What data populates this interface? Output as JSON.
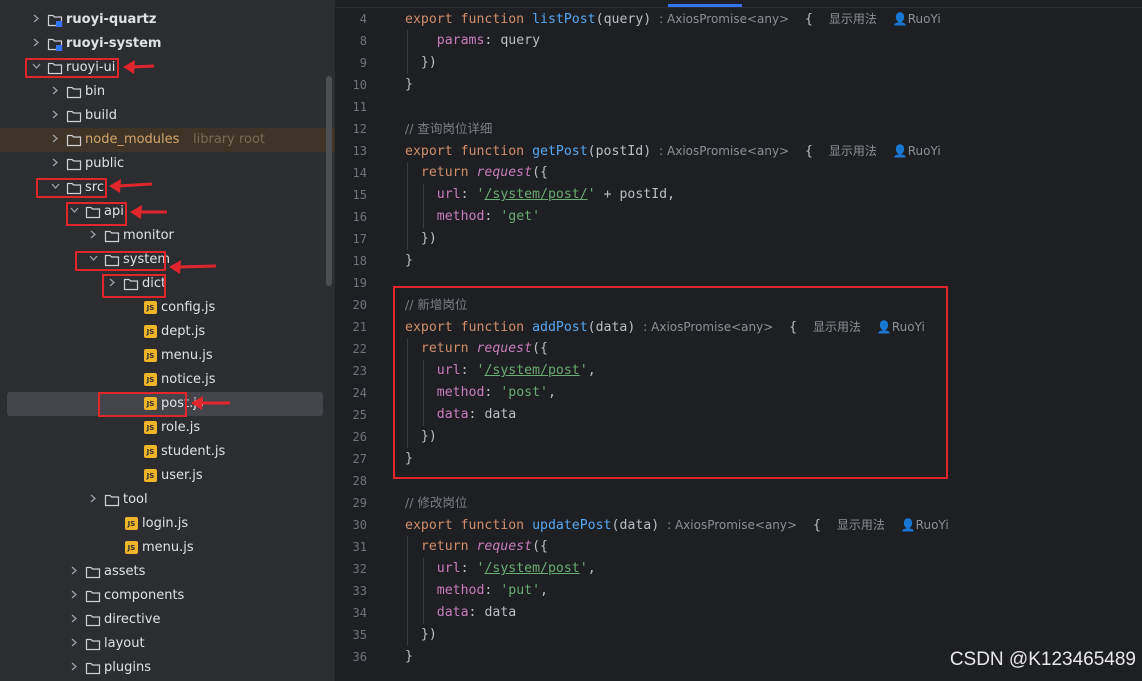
{
  "colors": {
    "annotation": "#e0252c",
    "selection": "#43454a",
    "accent": "#3574f0"
  },
  "tree": {
    "items": [
      {
        "label": "ruoyi-quartz",
        "icon": "module-folder-icon",
        "expanded": false
      },
      {
        "label": "ruoyi-system",
        "icon": "module-folder-icon",
        "expanded": false
      },
      {
        "label": "ruoyi-ui",
        "icon": "folder-icon",
        "expanded": true
      },
      {
        "label": "bin",
        "icon": "folder-icon",
        "expanded": false
      },
      {
        "label": "build",
        "icon": "folder-icon",
        "expanded": false
      },
      {
        "label": "node_modules",
        "hint": "library root",
        "icon": "folder-icon",
        "expanded": false
      },
      {
        "label": "public",
        "icon": "folder-icon",
        "expanded": false
      },
      {
        "label": "src",
        "icon": "folder-icon",
        "expanded": true
      },
      {
        "label": "api",
        "icon": "folder-icon",
        "expanded": true
      },
      {
        "label": "monitor",
        "icon": "folder-icon",
        "expanded": false
      },
      {
        "label": "system",
        "icon": "folder-icon",
        "expanded": true
      },
      {
        "label": "dict",
        "icon": "folder-icon",
        "expanded": false
      },
      {
        "label": "config.js",
        "icon": "js-file-icon"
      },
      {
        "label": "dept.js",
        "icon": "js-file-icon"
      },
      {
        "label": "menu.js",
        "icon": "js-file-icon"
      },
      {
        "label": "notice.js",
        "icon": "js-file-icon"
      },
      {
        "label": "post.js",
        "icon": "js-file-icon",
        "selected": true
      },
      {
        "label": "role.js",
        "icon": "js-file-icon"
      },
      {
        "label": "student.js",
        "icon": "js-file-icon"
      },
      {
        "label": "user.js",
        "icon": "js-file-icon"
      },
      {
        "label": "tool",
        "icon": "folder-icon",
        "expanded": false
      },
      {
        "label": "login.js",
        "icon": "js-file-icon"
      },
      {
        "label": "menu.js",
        "icon": "js-file-icon"
      },
      {
        "label": "assets",
        "icon": "folder-icon",
        "expanded": false
      },
      {
        "label": "components",
        "icon": "folder-icon",
        "expanded": false
      },
      {
        "label": "directive",
        "icon": "folder-icon",
        "expanded": false
      },
      {
        "label": "layout",
        "icon": "folder-icon",
        "expanded": false
      },
      {
        "label": "plugins",
        "icon": "folder-icon",
        "expanded": false
      }
    ]
  },
  "editor": {
    "line_numbers": [
      "4",
      "8",
      "9",
      "10",
      "11",
      "12",
      "13",
      "14",
      "15",
      "16",
      "17",
      "18",
      "19",
      "20",
      "21",
      "22",
      "23",
      "24",
      "25",
      "26",
      "27",
      "28",
      "29",
      "30",
      "31",
      "32",
      "33",
      "34",
      "35",
      "36"
    ],
    "tokens": {
      "export": "export",
      "function": "function",
      "return": "return",
      "request": "request",
      "url": "url",
      "method": "method",
      "data_key": "data",
      "params": "params",
      "query": "query",
      "postId": "postId",
      "data": "data",
      "close_brace": "}",
      "close_call": "})",
      "open_call": "({",
      "open_brace": "{",
      "colon": ":",
      "comma": ",",
      "plus": "+"
    },
    "functions": [
      {
        "name": "listPost",
        "param": "query",
        "type": "AxiosPromise<any>"
      },
      {
        "name": "getPost",
        "param": "postId",
        "type": "AxiosPromise<any>",
        "comment": "// 查询岗位详细",
        "url": "/system/post/",
        "method": "'get'"
      },
      {
        "name": "addPost",
        "param": "data",
        "type": "AxiosPromise<any>",
        "comment": "// 新增岗位",
        "url": "/system/post",
        "method": "'post'"
      },
      {
        "name": "updatePost",
        "param": "data",
        "type": "AxiosPromise<any>",
        "comment": "// 修改岗位",
        "url": "/system/post",
        "method": "'put'"
      }
    ],
    "usage_hint": "显示用法",
    "author": "RuoYi"
  },
  "watermark": "CSDN @K123465489"
}
